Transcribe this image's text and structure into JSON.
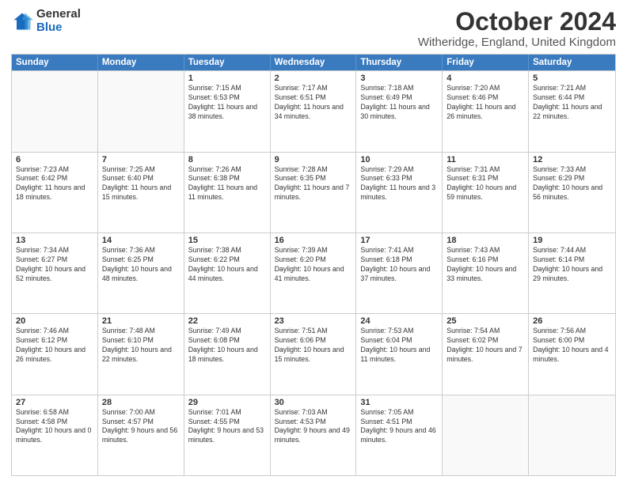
{
  "logo": {
    "general": "General",
    "blue": "Blue"
  },
  "header": {
    "title": "October 2024",
    "subtitle": "Witheridge, England, United Kingdom"
  },
  "weekdays": [
    "Sunday",
    "Monday",
    "Tuesday",
    "Wednesday",
    "Thursday",
    "Friday",
    "Saturday"
  ],
  "weeks": [
    [
      {
        "day": "",
        "text": "",
        "empty": true
      },
      {
        "day": "",
        "text": "",
        "empty": true
      },
      {
        "day": "1",
        "text": "Sunrise: 7:15 AM\nSunset: 6:53 PM\nDaylight: 11 hours and 38 minutes."
      },
      {
        "day": "2",
        "text": "Sunrise: 7:17 AM\nSunset: 6:51 PM\nDaylight: 11 hours and 34 minutes."
      },
      {
        "day": "3",
        "text": "Sunrise: 7:18 AM\nSunset: 6:49 PM\nDaylight: 11 hours and 30 minutes."
      },
      {
        "day": "4",
        "text": "Sunrise: 7:20 AM\nSunset: 6:46 PM\nDaylight: 11 hours and 26 minutes."
      },
      {
        "day": "5",
        "text": "Sunrise: 7:21 AM\nSunset: 6:44 PM\nDaylight: 11 hours and 22 minutes."
      }
    ],
    [
      {
        "day": "6",
        "text": "Sunrise: 7:23 AM\nSunset: 6:42 PM\nDaylight: 11 hours and 18 minutes."
      },
      {
        "day": "7",
        "text": "Sunrise: 7:25 AM\nSunset: 6:40 PM\nDaylight: 11 hours and 15 minutes."
      },
      {
        "day": "8",
        "text": "Sunrise: 7:26 AM\nSunset: 6:38 PM\nDaylight: 11 hours and 11 minutes."
      },
      {
        "day": "9",
        "text": "Sunrise: 7:28 AM\nSunset: 6:35 PM\nDaylight: 11 hours and 7 minutes."
      },
      {
        "day": "10",
        "text": "Sunrise: 7:29 AM\nSunset: 6:33 PM\nDaylight: 11 hours and 3 minutes."
      },
      {
        "day": "11",
        "text": "Sunrise: 7:31 AM\nSunset: 6:31 PM\nDaylight: 10 hours and 59 minutes."
      },
      {
        "day": "12",
        "text": "Sunrise: 7:33 AM\nSunset: 6:29 PM\nDaylight: 10 hours and 56 minutes."
      }
    ],
    [
      {
        "day": "13",
        "text": "Sunrise: 7:34 AM\nSunset: 6:27 PM\nDaylight: 10 hours and 52 minutes."
      },
      {
        "day": "14",
        "text": "Sunrise: 7:36 AM\nSunset: 6:25 PM\nDaylight: 10 hours and 48 minutes."
      },
      {
        "day": "15",
        "text": "Sunrise: 7:38 AM\nSunset: 6:22 PM\nDaylight: 10 hours and 44 minutes."
      },
      {
        "day": "16",
        "text": "Sunrise: 7:39 AM\nSunset: 6:20 PM\nDaylight: 10 hours and 41 minutes."
      },
      {
        "day": "17",
        "text": "Sunrise: 7:41 AM\nSunset: 6:18 PM\nDaylight: 10 hours and 37 minutes."
      },
      {
        "day": "18",
        "text": "Sunrise: 7:43 AM\nSunset: 6:16 PM\nDaylight: 10 hours and 33 minutes."
      },
      {
        "day": "19",
        "text": "Sunrise: 7:44 AM\nSunset: 6:14 PM\nDaylight: 10 hours and 29 minutes."
      }
    ],
    [
      {
        "day": "20",
        "text": "Sunrise: 7:46 AM\nSunset: 6:12 PM\nDaylight: 10 hours and 26 minutes."
      },
      {
        "day": "21",
        "text": "Sunrise: 7:48 AM\nSunset: 6:10 PM\nDaylight: 10 hours and 22 minutes."
      },
      {
        "day": "22",
        "text": "Sunrise: 7:49 AM\nSunset: 6:08 PM\nDaylight: 10 hours and 18 minutes."
      },
      {
        "day": "23",
        "text": "Sunrise: 7:51 AM\nSunset: 6:06 PM\nDaylight: 10 hours and 15 minutes."
      },
      {
        "day": "24",
        "text": "Sunrise: 7:53 AM\nSunset: 6:04 PM\nDaylight: 10 hours and 11 minutes."
      },
      {
        "day": "25",
        "text": "Sunrise: 7:54 AM\nSunset: 6:02 PM\nDaylight: 10 hours and 7 minutes."
      },
      {
        "day": "26",
        "text": "Sunrise: 7:56 AM\nSunset: 6:00 PM\nDaylight: 10 hours and 4 minutes."
      }
    ],
    [
      {
        "day": "27",
        "text": "Sunrise: 6:58 AM\nSunset: 4:58 PM\nDaylight: 10 hours and 0 minutes."
      },
      {
        "day": "28",
        "text": "Sunrise: 7:00 AM\nSunset: 4:57 PM\nDaylight: 9 hours and 56 minutes."
      },
      {
        "day": "29",
        "text": "Sunrise: 7:01 AM\nSunset: 4:55 PM\nDaylight: 9 hours and 53 minutes."
      },
      {
        "day": "30",
        "text": "Sunrise: 7:03 AM\nSunset: 4:53 PM\nDaylight: 9 hours and 49 minutes."
      },
      {
        "day": "31",
        "text": "Sunrise: 7:05 AM\nSunset: 4:51 PM\nDaylight: 9 hours and 46 minutes."
      },
      {
        "day": "",
        "text": "",
        "empty": true
      },
      {
        "day": "",
        "text": "",
        "empty": true
      }
    ]
  ]
}
